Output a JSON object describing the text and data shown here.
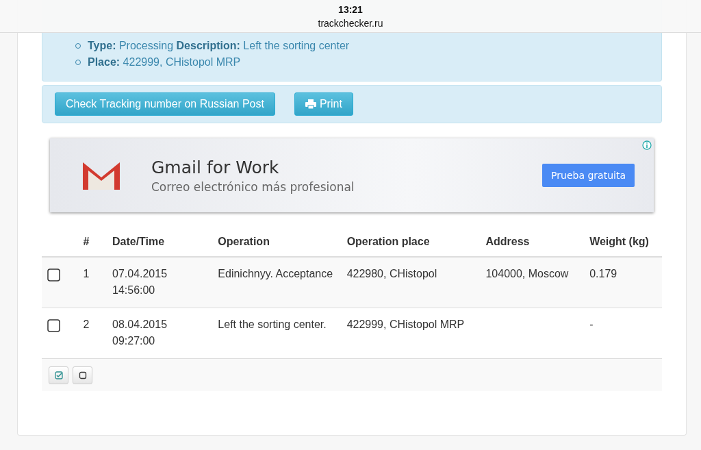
{
  "browser": {
    "time": "13:21",
    "url": "trackchecker.ru"
  },
  "details": [
    {
      "parts": [
        {
          "label": "Type:",
          "value": "Processing"
        },
        {
          "label": "Description:",
          "value": "Left the sorting center"
        }
      ]
    },
    {
      "parts": [
        {
          "label": "Place:",
          "value": "422999, CHistopol MRP"
        }
      ]
    }
  ],
  "actions": [
    {
      "label": "Check Tracking number on Russian Post",
      "kind": "text"
    },
    {
      "label": "Print",
      "kind": "print"
    }
  ],
  "ad": {
    "title": "Gmail for Work",
    "subtitle": "Correo electrónico más profesional",
    "button": "Prueba gratuita"
  },
  "table": {
    "columns": [
      "#",
      "Date/Time",
      "Operation",
      "Operation place",
      "Address",
      "Weight (kg)"
    ],
    "rows": [
      {
        "checked": false,
        "cells": [
          "1",
          "07.04.2015 14:56:00",
          "Edinichnyy. Acceptance",
          "422980, CHistopol",
          "104000, Moscow",
          "0.179"
        ]
      },
      {
        "checked": false,
        "cells": [
          "2",
          "08.04.2015 09:27:00",
          "Left the sorting center.",
          "422999, CHistopol MRP",
          "",
          "-"
        ]
      }
    ]
  }
}
